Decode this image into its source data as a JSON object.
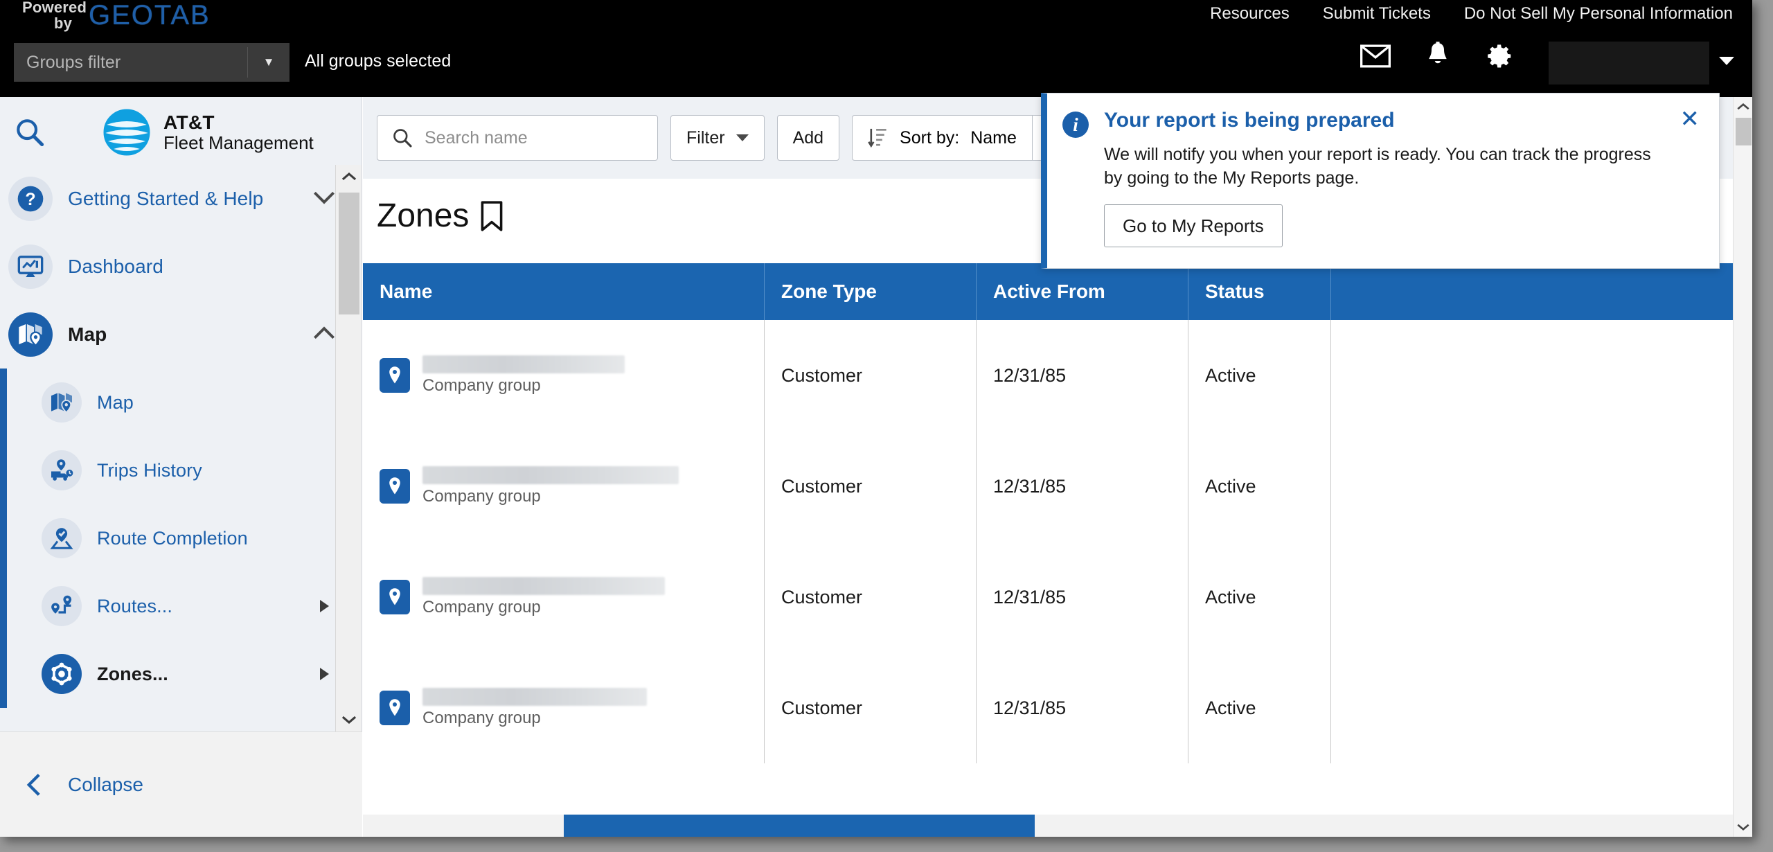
{
  "topbar": {
    "powered": "Powered",
    "by": "by",
    "brand": "GEOTAB",
    "links": [
      {
        "label": "Resources"
      },
      {
        "label": "Submit Tickets"
      },
      {
        "label": "Do Not Sell My Personal Information"
      }
    ],
    "groups_filter_placeholder": "Groups filter",
    "groups_status": "All groups selected",
    "icons": [
      "mail-icon",
      "bell-icon",
      "gear-icon",
      "person-icon"
    ],
    "account_name": ""
  },
  "sidebar": {
    "search_icon": "search-icon",
    "brand_line1": "AT&T",
    "brand_line2": "Fleet Management",
    "items": [
      {
        "label": "Getting Started & Help",
        "icon": "help-circle-icon",
        "chevron": "chevron-down",
        "active": false
      },
      {
        "label": "Dashboard",
        "icon": "dashboard-icon",
        "chevron": "",
        "active": false
      },
      {
        "label": "Map",
        "icon": "map-pin-icon",
        "chevron": "chevron-up",
        "active": true
      }
    ],
    "subitems": [
      {
        "label": "Map",
        "icon": "map-pin-icon",
        "arrow": false,
        "active": false
      },
      {
        "label": "Trips History",
        "icon": "trips-history-icon",
        "arrow": false,
        "active": false
      },
      {
        "label": "Route Completion",
        "icon": "route-completion-icon",
        "arrow": false,
        "active": false
      },
      {
        "label": "Routes...",
        "icon": "routes-icon",
        "arrow": true,
        "active": false
      },
      {
        "label": "Zones...",
        "icon": "zones-icon",
        "arrow": true,
        "active": true
      }
    ],
    "collapse_label": "Collapse"
  },
  "toolbar": {
    "search_placeholder": "Search name",
    "search_value": "",
    "filter_label": "Filter",
    "add_label": "Add",
    "sort_label": "Sort by:",
    "sort_value": "Name"
  },
  "page": {
    "title": "Zones",
    "bookmark_icon": "bookmark-icon"
  },
  "table": {
    "columns": [
      {
        "label": "Name"
      },
      {
        "label": "Zone Type"
      },
      {
        "label": "Active From"
      },
      {
        "label": "Status"
      }
    ],
    "rows": [
      {
        "name": "",
        "group": "Company group",
        "zone_type": "Customer",
        "active_from": "12/31/85",
        "status": "Active",
        "redact_width": 292
      },
      {
        "name": "",
        "group": "Company group",
        "zone_type": "Customer",
        "active_from": "12/31/85",
        "status": "Active",
        "redact_width": 370
      },
      {
        "name": "",
        "group": "Company group",
        "zone_type": "Customer",
        "active_from": "12/31/85",
        "status": "Active",
        "redact_width": 350
      },
      {
        "name": "",
        "group": "Company group",
        "zone_type": "Customer",
        "active_from": "12/31/85",
        "status": "Active",
        "redact_width": 324
      }
    ]
  },
  "notification": {
    "title": "Your report is being prepared",
    "body": "We will notify you when your report is ready. You can track the progress by going to the My Reports page.",
    "button_label": "Go to My Reports",
    "close_icon": "close-icon",
    "info_icon": "info-icon",
    "accent_color": "#1b65b0"
  },
  "colors": {
    "header_blue": "#1b65b0",
    "brand_blue": "#1b5faa",
    "topbar_black": "#000000",
    "sidebar_bg": "#eef1f5"
  }
}
